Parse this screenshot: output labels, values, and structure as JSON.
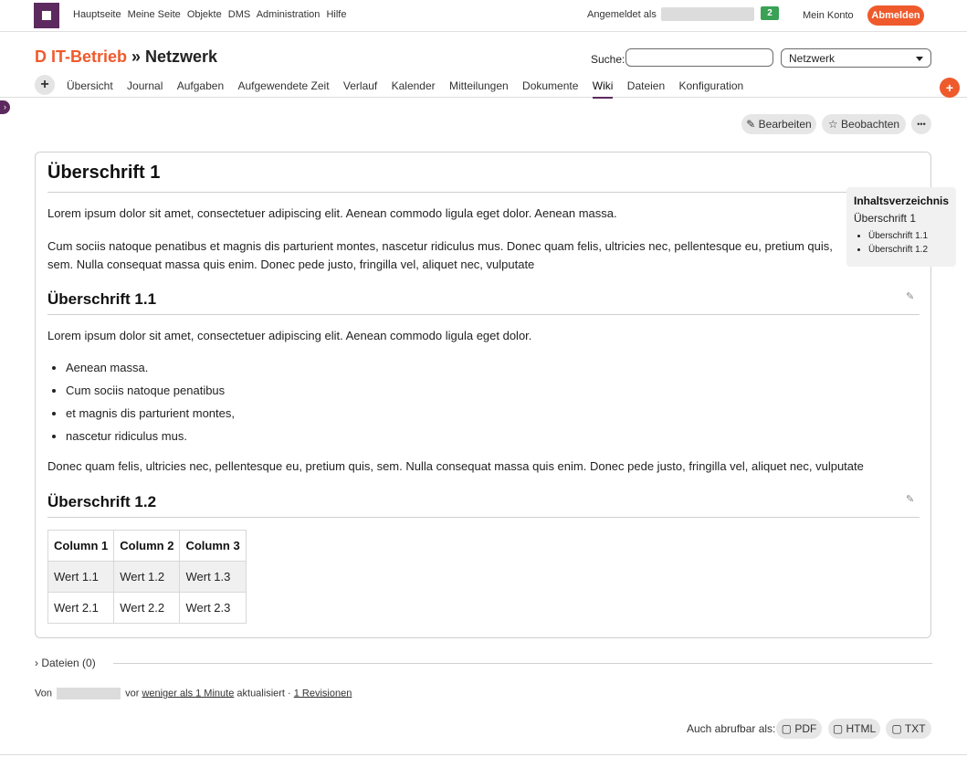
{
  "topbar": {
    "nav": [
      "Hauptseite",
      "Meine Seite",
      "Objekte",
      "DMS",
      "Administration",
      "Hilfe"
    ],
    "logged_in_label": "Angemeldet als",
    "badge_count": "2",
    "account": "Mein Konto",
    "logout": "Abmelden"
  },
  "project": {
    "parent": "D IT-Betrieb",
    "separator": " » ",
    "name": "Netzwerk",
    "search_label": "Suche:",
    "search_value": "",
    "scope": "Netzwerk"
  },
  "tabs": [
    "Übersicht",
    "Journal",
    "Aufgaben",
    "Aufgewendete Zeit",
    "Verlauf",
    "Kalender",
    "Mitteilungen",
    "Dokumente",
    "Wiki",
    "Dateien",
    "Konfiguration"
  ],
  "active_tab": "Wiki",
  "actions": {
    "edit": "Bearbeiten",
    "watch": "Beobachten",
    "more": "•••"
  },
  "wiki": {
    "h1": "Überschrift 1",
    "p1": "Lorem ipsum dolor sit amet, consectetuer adipiscing elit. Aenean commodo ligula eget dolor. Aenean massa.",
    "p2": "Cum sociis natoque penatibus et magnis dis parturient montes, nascetur ridiculus mus. Donec quam felis, ultricies nec, pellentesque eu, pretium quis, sem. Nulla consequat massa quis enim. Donec pede justo, fringilla vel, aliquet nec, vulputate",
    "h2a": "Überschrift 1.1",
    "p3": "Lorem ipsum dolor sit amet, consectetuer adipiscing elit. Aenean commodo ligula eget dolor.",
    "list": [
      "Aenean massa.",
      "Cum sociis natoque penatibus",
      "et magnis dis parturient montes,",
      "nascetur ridiculus mus."
    ],
    "p4": "Donec quam felis, ultricies nec, pellentesque eu, pretium quis, sem. Nulla consequat massa quis enim. Donec pede justo, fringilla vel, aliquet nec, vulputate",
    "h2b": "Überschrift 1.2",
    "table": {
      "headers": [
        "Column 1",
        "Column 2",
        "Column 3"
      ],
      "rows": [
        [
          "Wert 1.1",
          "Wert 1.2",
          "Wert 1.3"
        ],
        [
          "Wert 2.1",
          "Wert 2.2",
          "Wert 2.3"
        ]
      ]
    }
  },
  "toc": {
    "title": "Inhaltsverzeichnis",
    "top": "Überschrift 1",
    "items": [
      "Überschrift 1.1",
      "Überschrift 1.2"
    ]
  },
  "footer": {
    "files": "Dateien (0)",
    "by": "Von",
    "ago_prefix": "vor",
    "ago_link": "weniger als 1 Minute",
    "updated": "aktualisiert ·",
    "revisions": "1 Revisionen",
    "export_label": "Auch abrufbar als:",
    "export_pdf": "PDF",
    "export_html": "HTML",
    "export_txt": "TXT"
  }
}
